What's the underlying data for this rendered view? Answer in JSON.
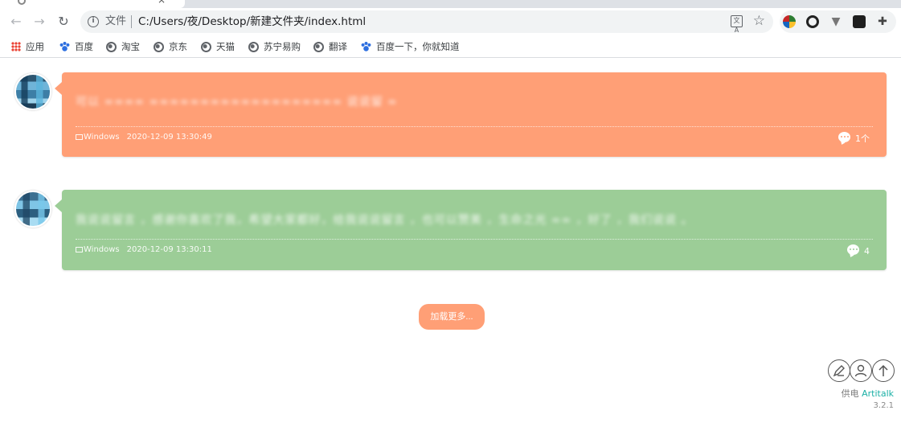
{
  "browser": {
    "address": {
      "scheme_label": "文件",
      "url": "C:/Users/夜/Desktop/新建文件夹/index.html"
    },
    "bookmarks": [
      {
        "label": "应用",
        "icon": "apps-grid-icon"
      },
      {
        "label": "百度",
        "icon": "baidu-paw-icon"
      },
      {
        "label": "淘宝",
        "icon": "globe-icon"
      },
      {
        "label": "京东",
        "icon": "globe-icon"
      },
      {
        "label": "天猫",
        "icon": "globe-icon"
      },
      {
        "label": "苏宁易购",
        "icon": "globe-icon"
      },
      {
        "label": "翻译",
        "icon": "globe-icon"
      },
      {
        "label": "百度一下，你就知道",
        "icon": "baidu-paw-icon"
      }
    ]
  },
  "comments": [
    {
      "bubble_color": "#ff9f76",
      "content_blurred": "可以 ∞∞∞∞ ∞∞∞∞∞∞∞∞∞∞∞∞∞∞∞∞∞∞∞ 说说留 ∞∞∞∞",
      "ua": "Windows",
      "time": "2020-12-09 13:30:49",
      "reply_count": "1个"
    },
    {
      "bubble_color": "#9ccd97",
      "content_blurred": "我说说留言 ，感谢你喜欢了我，希望大家都好，给我说说留言 ，也可以赞美 ，生命之光 ∞∞ ，好了 ，我们说说 。",
      "ua": "Windows",
      "time": "2020-12-09 13:30:11",
      "reply_count": "4"
    }
  ],
  "load_more_label": "加载更多...",
  "footer": {
    "powered_prefix": "供电",
    "powered_brand": "Artitalk",
    "version": "3.2.1"
  }
}
